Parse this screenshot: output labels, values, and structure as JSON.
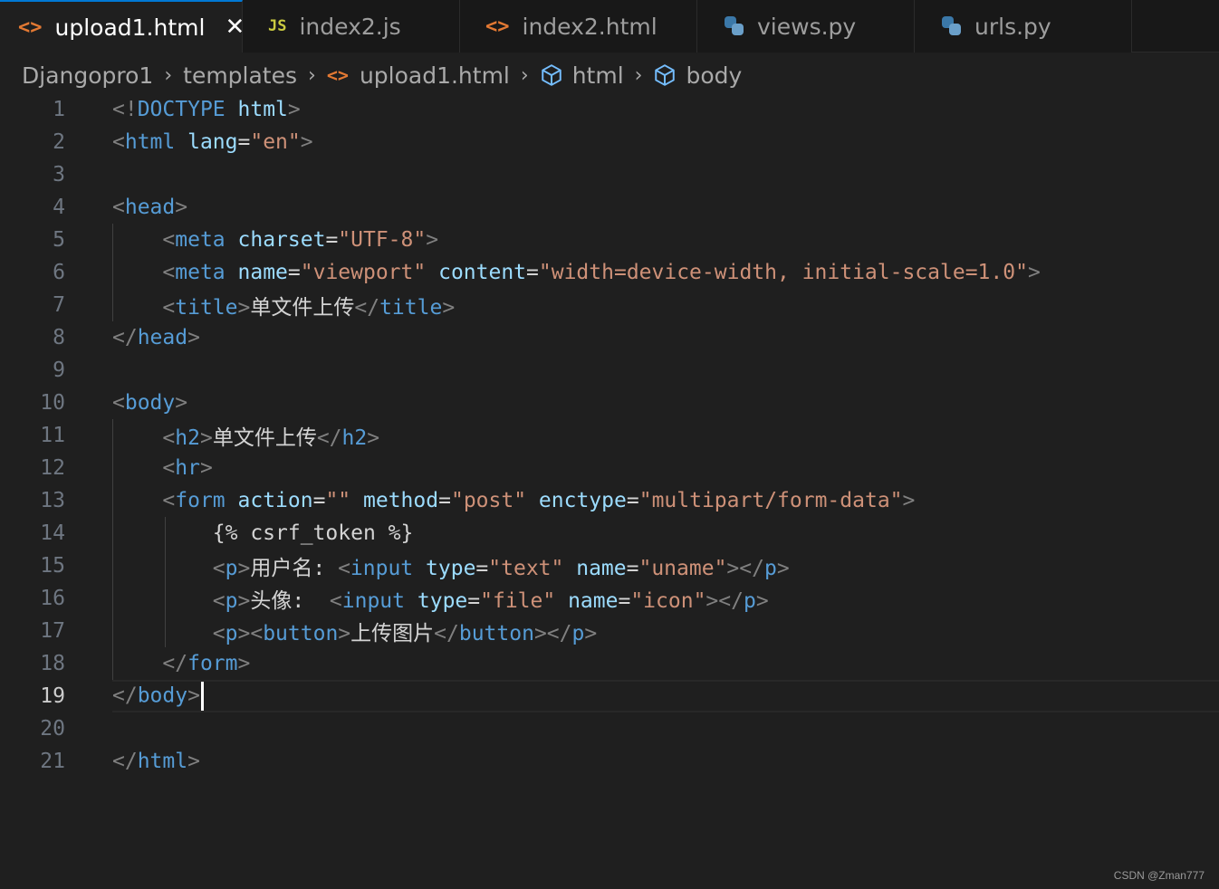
{
  "tabs": [
    {
      "label": "upload1.html",
      "icon": "html-icon",
      "active": true
    },
    {
      "label": "index2.js",
      "icon": "js-icon",
      "active": false
    },
    {
      "label": "index2.html",
      "icon": "html-icon",
      "active": false
    },
    {
      "label": "views.py",
      "icon": "python-icon",
      "active": false
    },
    {
      "label": "urls.py",
      "icon": "python-icon",
      "active": false
    }
  ],
  "breadcrumb": {
    "project": "Djangopro1",
    "folder": "templates",
    "file": "upload1.html",
    "element1": "html",
    "element2": "body"
  },
  "editor": {
    "current_line": 19,
    "line_numbers": [
      "1",
      "2",
      "3",
      "4",
      "5",
      "6",
      "7",
      "8",
      "9",
      "10",
      "11",
      "12",
      "13",
      "14",
      "15",
      "16",
      "17",
      "18",
      "19",
      "20",
      "21"
    ],
    "lines": {
      "l1": {
        "a": "<!",
        "b": "DOCTYPE",
        "c": "html",
        "d": ">"
      },
      "l2": {
        "a": "<",
        "b": "html",
        "c": "lang",
        "d": "=",
        "e": "\"en\"",
        "f": ">"
      },
      "l4": {
        "a": "<",
        "b": "head",
        "c": ">"
      },
      "l5": {
        "a": "<",
        "b": "meta",
        "c": "charset",
        "d": "=",
        "e": "\"UTF-8\"",
        "f": ">"
      },
      "l6": {
        "a": "<",
        "b": "meta",
        "c": "name",
        "d": "=",
        "e": "\"viewport\"",
        "f": "content",
        "g": "=",
        "h": "\"width=device-width, initial-scale=1.0\"",
        "i": ">"
      },
      "l7": {
        "a": "<",
        "b": "title",
        "c": ">",
        "d": "单文件上传",
        "e": "</",
        "f": "title",
        "g": ">"
      },
      "l8": {
        "a": "</",
        "b": "head",
        "c": ">"
      },
      "l10": {
        "a": "<",
        "b": "body",
        "c": ">"
      },
      "l11": {
        "a": "<",
        "b": "h2",
        "c": ">",
        "d": "单文件上传",
        "e": "</",
        "f": "h2",
        "g": ">"
      },
      "l12": {
        "a": "<",
        "b": "hr",
        "c": ">"
      },
      "l13": {
        "a": "<",
        "b": "form",
        "c": "action",
        "d": "=",
        "e": "\"\"",
        "f": "method",
        "g": "=",
        "h": "\"post\"",
        "i": "enctype",
        "j": "=",
        "k": "\"multipart/form-data\"",
        "l": ">"
      },
      "l14": {
        "a": "{% csrf_token %}"
      },
      "l15": {
        "a": "<",
        "b": "p",
        "c": ">",
        "d": "用户名: ",
        "e": "<",
        "f": "input",
        "g": "type",
        "h": "=",
        "i": "\"text\"",
        "j": "name",
        "k": "=",
        "l": "\"uname\"",
        "m": "></",
        "n": "p",
        "o": ">"
      },
      "l16": {
        "a": "<",
        "b": "p",
        "c": ">",
        "d": "头像:  ",
        "e": "<",
        "f": "input",
        "g": "type",
        "h": "=",
        "i": "\"file\"",
        "j": "name",
        "k": "=",
        "l": "\"icon\"",
        "m": "></",
        "n": "p",
        "o": ">"
      },
      "l17": {
        "a": "<",
        "b": "p",
        "c": "><",
        "d": "button",
        "e": ">",
        "f": "上传图片",
        "g": "</",
        "h": "button",
        "i": "></",
        "j": "p",
        "k": ">"
      },
      "l18": {
        "a": "</",
        "b": "form",
        "c": ">"
      },
      "l19": {
        "a": "</",
        "b": "body",
        "c": ">"
      },
      "l21": {
        "a": "</",
        "b": "html",
        "c": ">"
      }
    }
  },
  "watermark": "CSDN @Zman777",
  "colors": {
    "background": "#1f1f1f",
    "tag_bracket": "#808080",
    "tag_name": "#569cd6",
    "attribute": "#9cdcfe",
    "string": "#ce9178"
  }
}
